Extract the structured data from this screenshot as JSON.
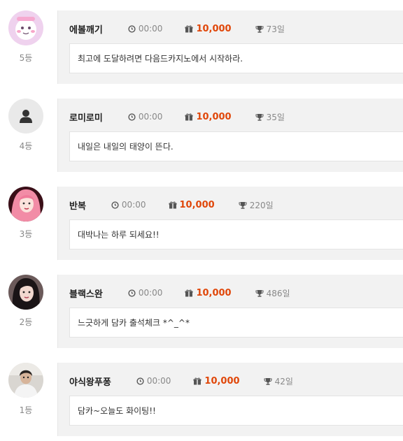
{
  "entries": [
    {
      "nickname": "에볼깨기",
      "time": "00:00",
      "points": "10,000",
      "days": "73일",
      "message": "최고에 도달하려면 다음드카지노에서 시작하라.",
      "rank": "5등",
      "avatar": "sticker-avatar"
    },
    {
      "nickname": "로미로미",
      "time": "00:00",
      "points": "10,000",
      "days": "35일",
      "message": "내일은 내일의 태양이 뜬다.",
      "rank": "4등",
      "avatar": "default-user-avatar"
    },
    {
      "nickname": "반복",
      "time": "00:00",
      "points": "10,000",
      "days": "220일",
      "message": "대박나는 하루 되세요!!",
      "rank": "3등",
      "avatar": "photo-avatar"
    },
    {
      "nickname": "블랙스완",
      "time": "00:00",
      "points": "10,000",
      "days": "486일",
      "message": "느긋하게 담카 출석체크 *^_^*",
      "rank": "2등",
      "avatar": "photo-avatar"
    },
    {
      "nickname": "야식왕푸퐁",
      "time": "00:00",
      "points": "10,000",
      "days": "42일",
      "message": "담카~오늘도 화이팅!!",
      "rank": "1등",
      "avatar": "photo-avatar"
    }
  ],
  "colors": {
    "points": "#e0470a",
    "card_bg": "#f2f2f2",
    "message_bg": "#ffffff",
    "muted_text": "#888888"
  },
  "icons": {
    "time": "clock-icon",
    "points": "gift-icon",
    "days": "trophy-icon"
  }
}
